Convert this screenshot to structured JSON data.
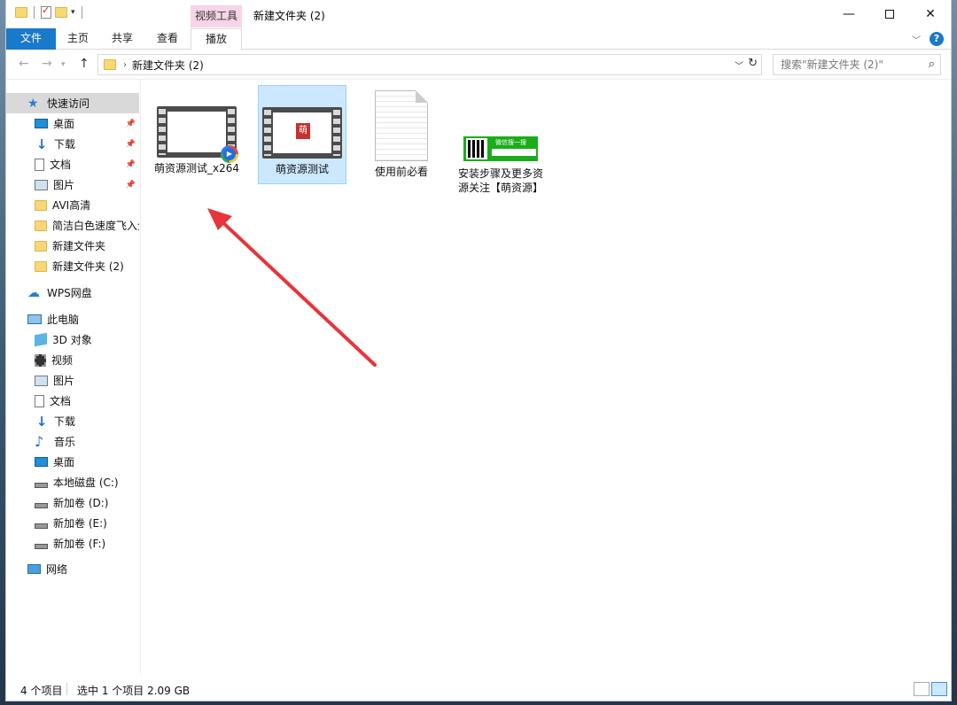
{
  "window": {
    "title": "新建文件夹 (2)",
    "context_tab": "视频工具",
    "controls": {
      "minimize": "—",
      "close": "✕"
    }
  },
  "ribbon": {
    "tabs": [
      "文件",
      "主页",
      "共享",
      "查看",
      "播放"
    ],
    "help": "?"
  },
  "address": {
    "path": "新建文件夹 (2)",
    "separator": "›",
    "search_placeholder": "搜索\"新建文件夹 (2)\""
  },
  "sidebar": {
    "quick_access": "快速访问",
    "pinned": [
      "桌面",
      "下载",
      "文档",
      "图片"
    ],
    "folders": [
      "AVI高清",
      "简洁白色速度飞入企",
      "新建文件夹",
      "新建文件夹 (2)"
    ],
    "wps": "WPS网盘",
    "this_pc": "此电脑",
    "pc_items": [
      "3D 对象",
      "视频",
      "图片",
      "文档",
      "下载",
      "音乐",
      "桌面"
    ],
    "drives": [
      "本地磁盘 (C:)",
      "新加卷 (D:)",
      "新加卷 (E:)",
      "新加卷 (F:)"
    ],
    "network": "网络"
  },
  "files": [
    {
      "name": "萌资源测试_x264",
      "type": "video",
      "selected": false
    },
    {
      "name": "萌资源测试",
      "type": "video",
      "selected": true,
      "stamp": "萌"
    },
    {
      "name": "使用前必看",
      "type": "document",
      "selected": false
    },
    {
      "name": "安装步骤及更多资源关注【萌资源】",
      "type": "image",
      "selected": false,
      "thumb_text": "微信搜一搜"
    }
  ],
  "status": {
    "item_count": "4 个项目",
    "selection": "选中 1 个项目  2.09 GB"
  },
  "colors": {
    "accent": "#1979ca",
    "selection": "#cce8ff",
    "context_tab": "#f7d4e8",
    "annotation_arrow": "#e8343a"
  }
}
